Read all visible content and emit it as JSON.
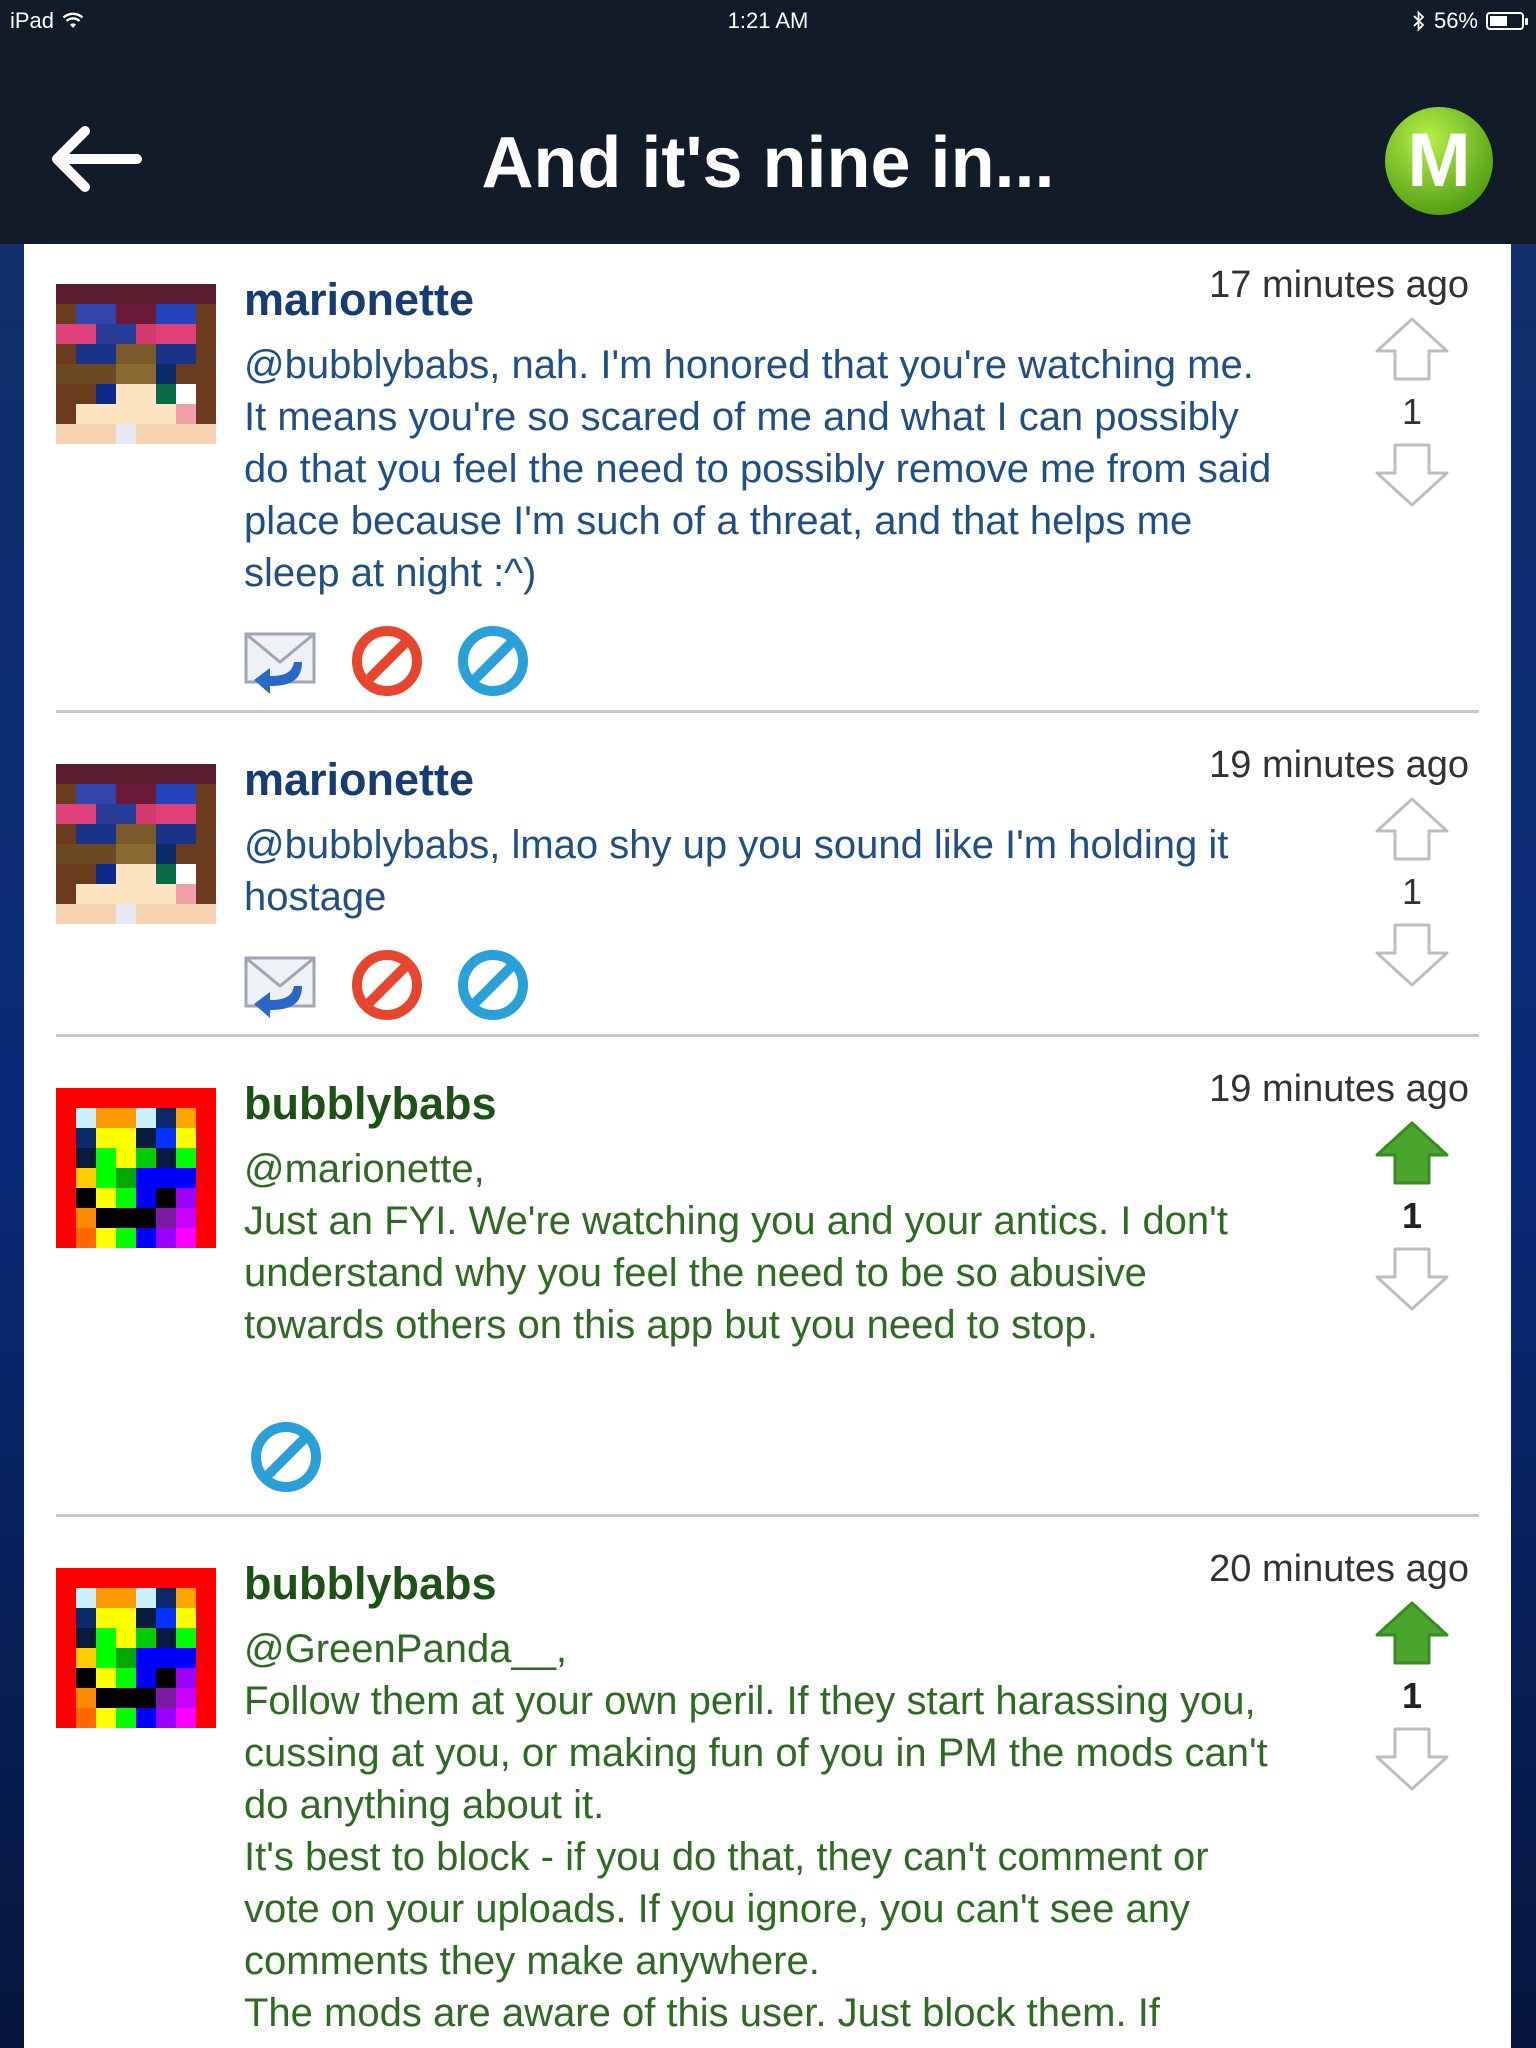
{
  "status_bar": {
    "device": "iPad",
    "time": "1:21 AM",
    "battery": "56%",
    "battery_level": 0.56
  },
  "header": {
    "title": "And it's nine in...",
    "logo_letter": "M"
  },
  "colors": {
    "nav_bg": "#121c28",
    "marionette_text": "#1f4f86",
    "bubbly_text": "#2e6a23",
    "upvote_active": "#4aa52e",
    "ignore_red": "#e8452f",
    "block_blue": "#2aa0d8"
  },
  "comments": [
    {
      "username": "marionette",
      "time": "17 minutes ago",
      "text": "@bubblybabs, nah. I'm honored that you're watching me. It means you're so scared of me and what I can possibly do that you feel the need to possibly remove me from said place because I'm such of a threat, and that helps me sleep at night :^)",
      "votes": "1"
    },
    {
      "username": "marionette",
      "time": "19 minutes ago",
      "text": "@bubblybabs, lmao shy up you sound like I'm holding it hostage",
      "votes": "1"
    },
    {
      "username": "bubblybabs",
      "time": "19 minutes ago",
      "text": "@marionette,\nJust an FYI. We're watching you and your antics. I don't understand why you feel the need to be so abusive towards others on this app but you need to stop.",
      "votes": "1"
    },
    {
      "username": "bubblybabs",
      "time": "20 minutes ago",
      "text": "@GreenPanda__,\nFollow them at your own peril. If they start harassing you, cussing at you, or making fun of you in PM the mods can't do anything about it.\nIt's best to block - if you do that, they can't comment or vote on your uploads. If you ignore, you can't see any comments they make anywhere.\nThe mods are aware of this user. Just block them. If",
      "votes": "1"
    }
  ],
  "icons": {
    "back": "back-arrow-icon",
    "reply": "reply-mail-icon",
    "ignore": "ignore-red-icon",
    "block": "block-blue-icon",
    "upvote": "upvote-arrow-icon",
    "downvote": "downvote-arrow-icon"
  }
}
